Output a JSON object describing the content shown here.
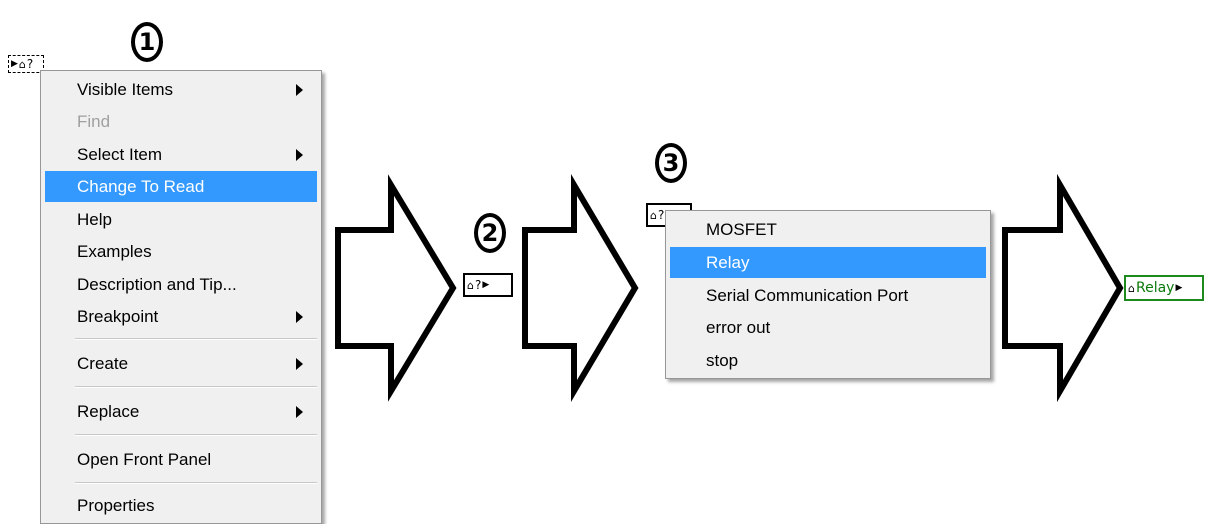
{
  "steps": {
    "one": "1",
    "two": "2",
    "three": "3"
  },
  "node_glyphs": {
    "arrow": "▶",
    "house": "⌂",
    "unknown": "?"
  },
  "result_node": {
    "label": "Relay"
  },
  "context_menu": {
    "items": [
      {
        "label": "Visible Items",
        "submenu": true
      },
      {
        "label": "Find",
        "disabled": true
      },
      {
        "label": "Select Item",
        "submenu": true
      },
      {
        "label": "Change To Read",
        "selected": true
      },
      {
        "label": "Help"
      },
      {
        "label": "Examples"
      },
      {
        "label": "Description and Tip..."
      },
      {
        "label": "Breakpoint",
        "submenu": true
      },
      {
        "label": "Create",
        "submenu": true
      },
      {
        "label": "Replace",
        "submenu": true
      },
      {
        "label": "Open Front Panel"
      },
      {
        "label": "Properties"
      }
    ]
  },
  "item_menu": {
    "items": [
      {
        "label": "MOSFET"
      },
      {
        "label": "Relay",
        "selected": true
      },
      {
        "label": "Serial Communication Port"
      },
      {
        "label": "error out"
      },
      {
        "label": "stop"
      }
    ]
  },
  "colors": {
    "selection": "#3399ff",
    "menu_background": "#f0f0f0",
    "result_border": "#1d8a1d",
    "result_text": "#0a7a0a"
  },
  "icons": [
    "flow-arrow-icon",
    "house-icon",
    "submenu-arrow-icon",
    "triangle-arrow-icon"
  ]
}
